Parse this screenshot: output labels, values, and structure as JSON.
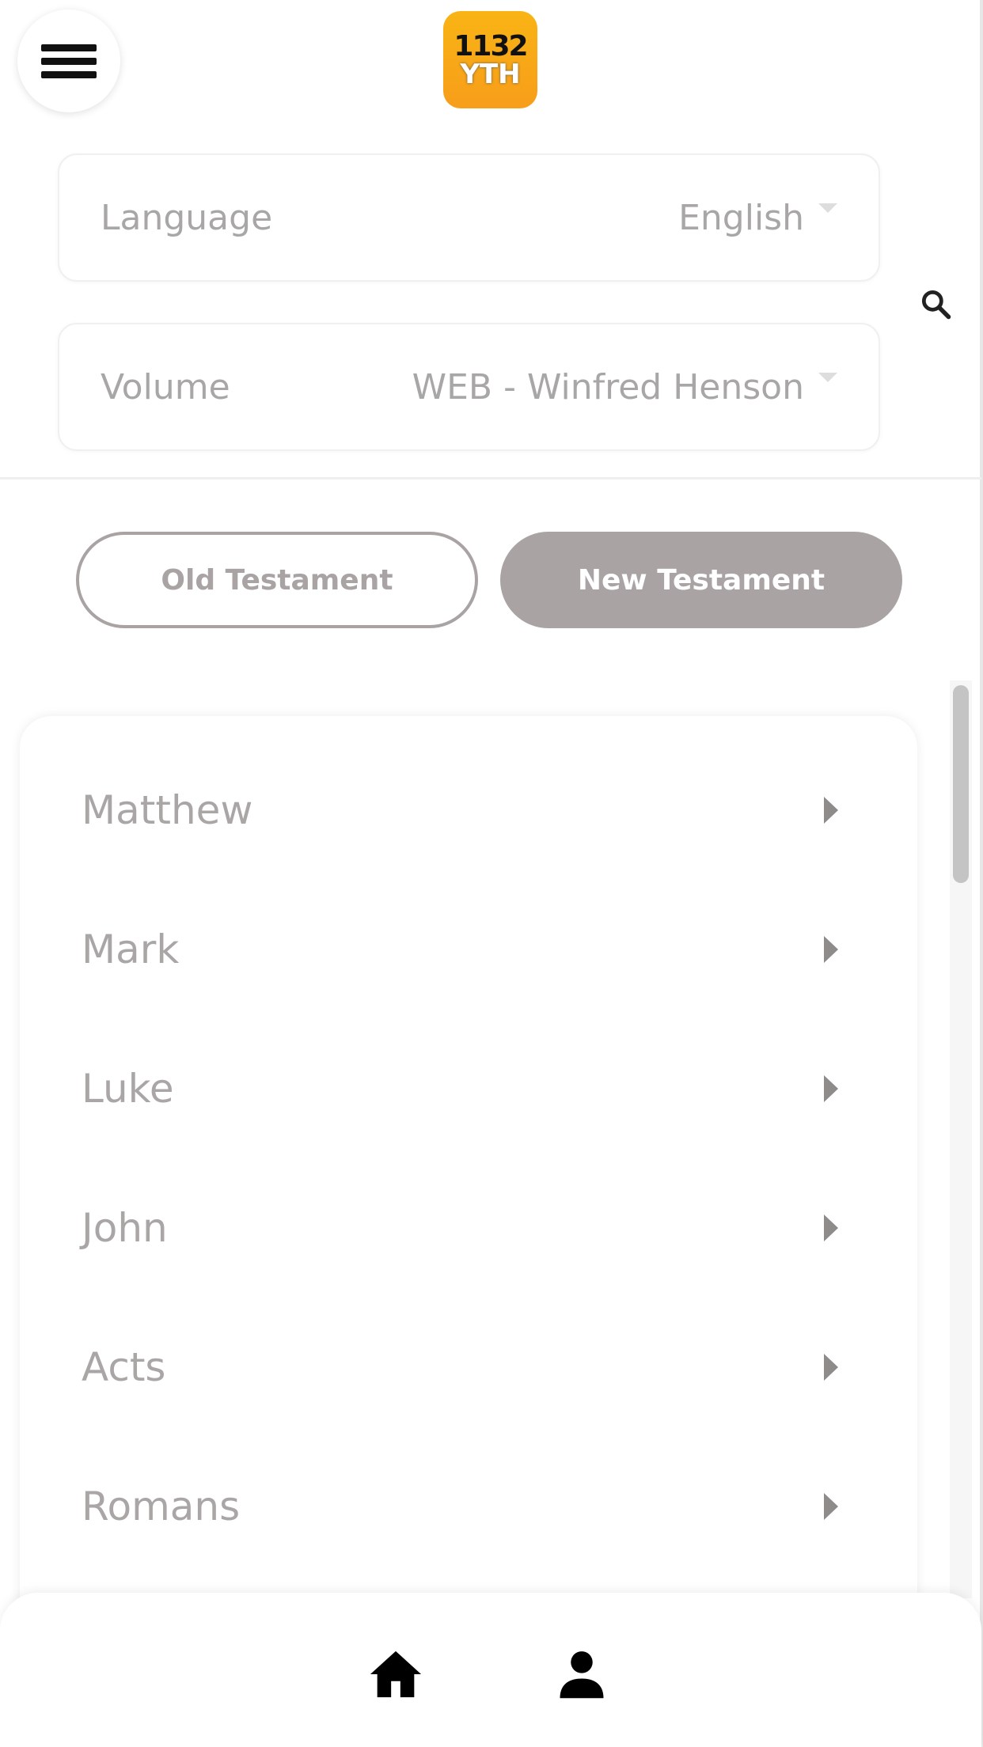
{
  "header": {
    "menu_icon": "hamburger-icon",
    "logo": {
      "line1": "1132",
      "line2": "YTH"
    },
    "search_icon": "search-icon"
  },
  "filters": {
    "language": {
      "label": "Language",
      "value": "English"
    },
    "volume": {
      "label": "Volume",
      "value": "WEB - Winfred Henson"
    }
  },
  "testament_toggle": {
    "old_label": "Old Testament",
    "new_label": "New Testament",
    "selected": "New Testament",
    "accent": "#a9a3a3"
  },
  "books": [
    {
      "name": "Matthew"
    },
    {
      "name": "Mark"
    },
    {
      "name": "Luke"
    },
    {
      "name": "John"
    },
    {
      "name": "Acts"
    },
    {
      "name": "Romans"
    }
  ],
  "bottom_nav": {
    "items": [
      {
        "icon": "home-icon"
      },
      {
        "icon": "person-icon"
      }
    ]
  }
}
